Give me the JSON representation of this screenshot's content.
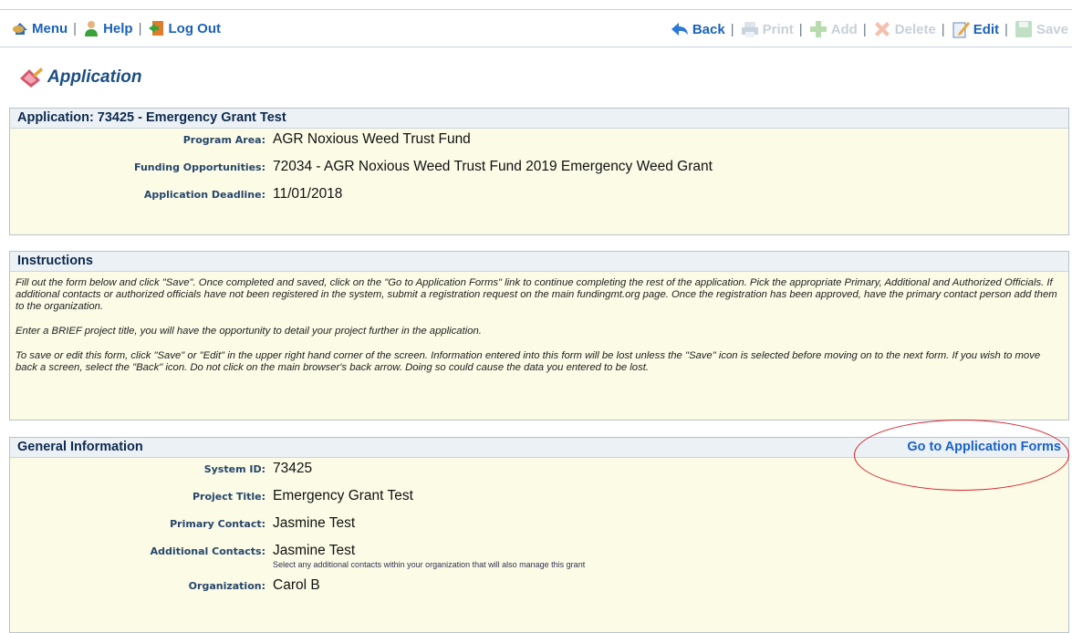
{
  "toolbar": {
    "left": [
      {
        "label": "Menu",
        "icon": "menu-icon"
      },
      {
        "label": "Help",
        "icon": "help-person-icon"
      },
      {
        "label": "Log Out",
        "icon": "logout-icon"
      }
    ],
    "right": [
      {
        "label": "Back",
        "icon": "back-arrow-icon",
        "enabled": true
      },
      {
        "label": "Print",
        "icon": "print-icon",
        "enabled": false
      },
      {
        "label": "Add",
        "icon": "add-icon",
        "enabled": false
      },
      {
        "label": "Delete",
        "icon": "delete-icon",
        "enabled": false
      },
      {
        "label": "Edit",
        "icon": "edit-icon",
        "enabled": true
      },
      {
        "label": "Save",
        "icon": "save-icon",
        "enabled": false
      }
    ],
    "separator": "|"
  },
  "page": {
    "title": "Application"
  },
  "application": {
    "header": "Application: 73425 - Emergency Grant Test",
    "program_area_label": "Program Area:",
    "program_area_value": "AGR Noxious Weed Trust Fund",
    "funding_label": "Funding Opportunities:",
    "funding_value": "72034 - AGR Noxious Weed Trust Fund 2019 Emergency Weed Grant",
    "deadline_label": "Application Deadline:",
    "deadline_value": "11/01/2018"
  },
  "instructions": {
    "header": "Instructions",
    "p1": "Fill out the form below and click \"Save\". Once completed and saved, click on the \"Go to Application Forms\" link to continue completing the rest of the application. Pick the appropriate Primary, Additional and Authorized Officials. If additional contacts or authorized officials have not been registered in the system, submit a registration request on the main fundingmt.org page. Once the registration has been approved, have the primary contact person add them to the organization.",
    "p2": "Enter a BRIEF project title, you will have the opportunity to detail your project further in the application.",
    "p3": "To save or edit this form, click \"Save\" or \"Edit\" in the upper right hand corner of the screen. Information entered into this form will be lost unless the \"Save\" icon is selected before moving on to the next form. If you wish to move back a screen, select the \"Back\" icon. Do not click on the main browser's back arrow. Doing so could cause the data you entered to be lost."
  },
  "general": {
    "header": "General Information",
    "go_link": "Go to Application Forms",
    "system_id_label": "System ID:",
    "system_id_value": "73425",
    "project_title_label": "Project Title:",
    "project_title_value": "Emergency Grant Test",
    "primary_contact_label": "Primary Contact:",
    "primary_contact_value": "Jasmine Test",
    "additional_contacts_label": "Additional Contacts:",
    "additional_contacts_value": "Jasmine Test",
    "additional_contacts_hint": "Select any additional contacts within your organization that will also manage this grant",
    "organization_label": "Organization:",
    "organization_value": "Carol B"
  },
  "colors": {
    "link": "#1a62c8",
    "highlight_oval": "#d8202a",
    "panel_bg": "#fbfbe6"
  }
}
